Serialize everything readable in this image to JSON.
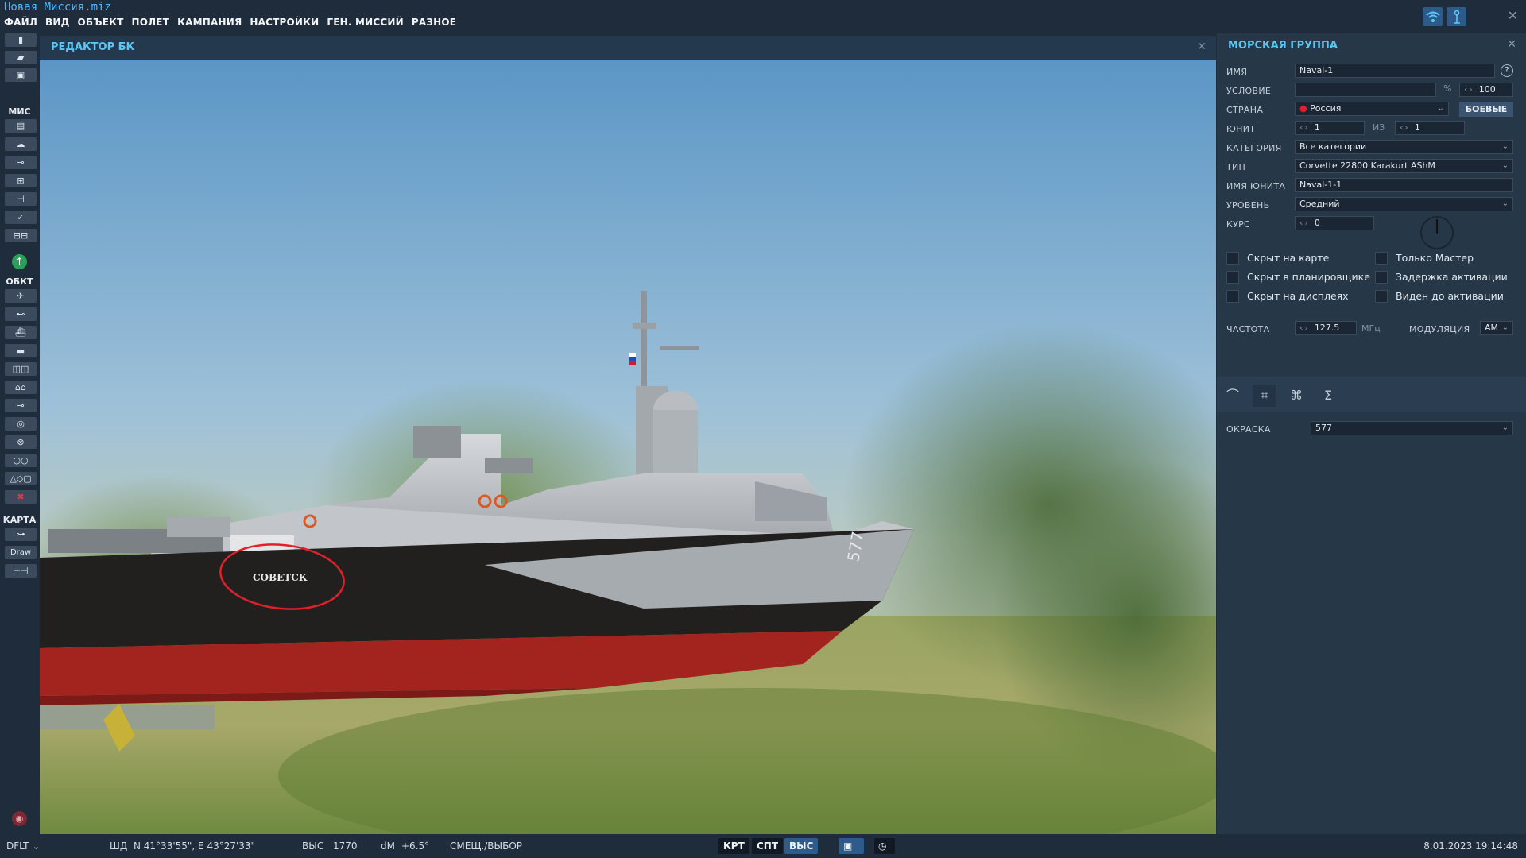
{
  "app": {
    "title": "Новая Миссия.miz"
  },
  "menu": [
    "ФАЙЛ",
    "ВИД",
    "ОБЪЕКТ",
    "ПОЛЕТ",
    "КАМПАНИЯ",
    "НАСТРОЙКИ",
    "ГЕН. МИССИЙ",
    "РАЗНОЕ"
  ],
  "toolbar": {
    "section_mission": "МИС",
    "section_objects": "ОБКТ",
    "section_map": "КАРТА",
    "draw_label": "Draw"
  },
  "editor": {
    "title": "РЕДАКТОР БК",
    "ship_name": "СОВЕТСК",
    "hull_number": "577"
  },
  "panel": {
    "title": "МОРСКАЯ ГРУППА",
    "name_label": "ИМЯ",
    "name_value": "Naval-1",
    "condition_label": "УСЛОВИЕ",
    "condition_value": "",
    "percent_sign": "%",
    "condition_percent": "100",
    "country_label": "СТРАНА",
    "country_value": "Россия",
    "combat_button": "БОЕВЫЕ",
    "unit_label": "ЮНИТ",
    "unit_value": "1",
    "of_label": "ИЗ",
    "unit_total": "1",
    "category_label": "КАТЕГОРИЯ",
    "category_value": "Все категории",
    "type_label": "ТИП",
    "type_value": "Corvette 22800 Karakurt AShM",
    "unit_name_label": "ИМЯ ЮНИТА",
    "unit_name_value": "Naval-1-1",
    "level_label": "УРОВЕНЬ",
    "level_value": "Средний",
    "course_label": "КУРС",
    "course_value": "0",
    "checkboxes": {
      "hidden_map": "Скрыт на карте",
      "hidden_planner": "Скрыт в планировщике",
      "hidden_displays": "Скрыт на дисплеях",
      "master_only": "Только Мастер",
      "late_activation": "Задержка активации",
      "visible_before": "Виден до активации"
    },
    "frequency_label": "ЧАСТОТА",
    "frequency_value": "127.5",
    "frequency_unit": "МГц",
    "modulation_label": "МОДУЛЯЦИЯ",
    "modulation_value": "AM",
    "livery_label": "ОКРАСКА",
    "livery_value": "577"
  },
  "statusbar": {
    "profile": "DFLT",
    "coord_label": "ШД",
    "coord_value": "N 41°33'55\", E 43°27'33\"",
    "alt_label": "ВЫС",
    "alt_value": "1770",
    "dm_label": "dM",
    "dm_value": "+6.5°",
    "mode": "СМЕЩ./ВЫБОР",
    "btn_krt": "КРТ",
    "btn_spt": "СПТ",
    "btn_vys": "ВЫС",
    "datetime": "8.01.2023 19:14:48"
  },
  "colors": {
    "accent": "#5bc6f2",
    "panel": "#263848",
    "background": "#1f2c3b",
    "hull_red": "#a3231f",
    "annotation": "#e0202a"
  }
}
